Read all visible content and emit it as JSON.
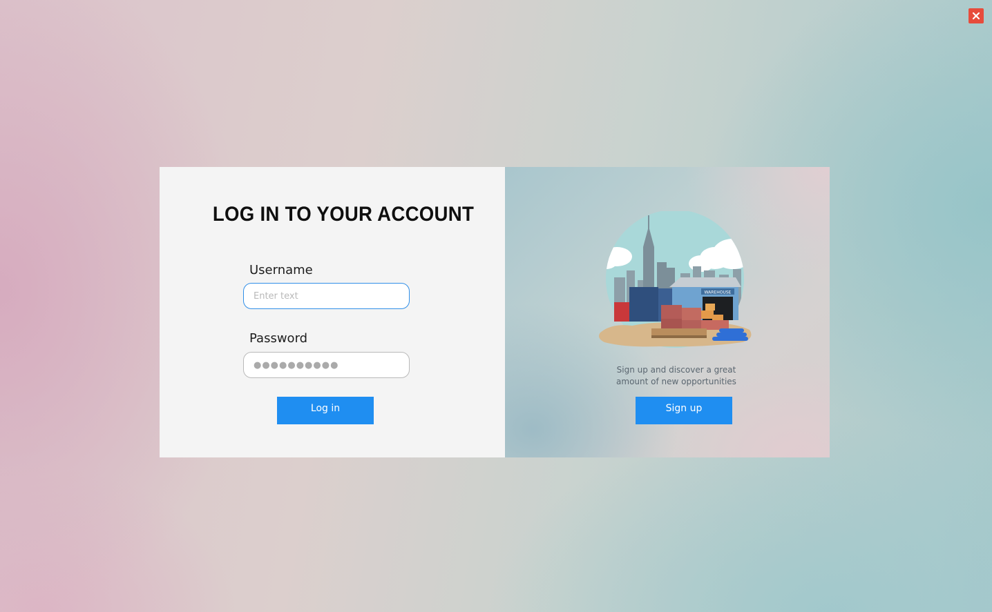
{
  "window": {
    "close_icon": "close-icon",
    "close_color": "#e74c3c"
  },
  "login": {
    "title": "LOG IN TO YOUR ACCOUNT",
    "username_label": "Username",
    "username_placeholder": "Enter text",
    "username_value": "",
    "password_label": "Password",
    "password_value": "●●●●●●●●●●",
    "submit_label": "Log in"
  },
  "signup": {
    "illustration": "warehouse-illustration",
    "illustration_text": "WAREHOUSE",
    "tagline_line1": "Sign up and discover a great",
    "tagline_line2": "amount of new opportunities",
    "button_label": "Sign up"
  },
  "colors": {
    "accent": "#1f8ef1",
    "input_focus": "#2f8ee8",
    "panel_bg": "#f4f4f4"
  }
}
